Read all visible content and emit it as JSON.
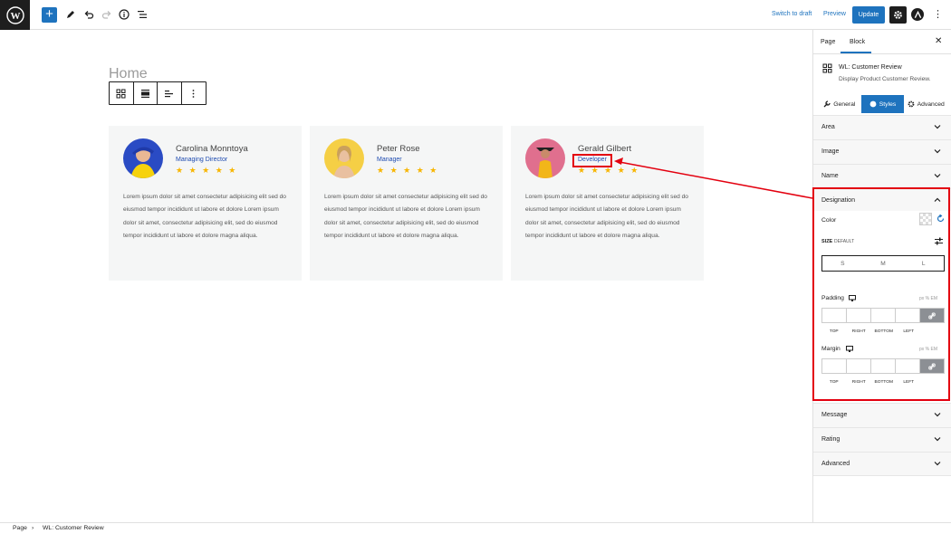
{
  "topbar": {
    "add_symbol": "+",
    "switch_to_draft": "Switch to draft",
    "preview": "Preview",
    "update": "Update",
    "more": "⋮",
    "icons": [
      "wordpress-icon",
      "pencil-icon",
      "undo-icon",
      "redo-icon",
      "info-icon",
      "list-view-icon",
      "gear-icon",
      "astra-icon"
    ]
  },
  "canvas": {
    "page_title": "Home",
    "cards": [
      {
        "name": "Carolina Monntoya",
        "designation": "Managing Director",
        "stars": "★ ★ ★ ★ ★",
        "rating": 5,
        "message": "Lorem ipsum dolor sit amet consectetur adipisicing elit sed do eiusmod tempor incididunt ut labore et dolore Lorem ipsum dolor sit amet, consectetur adipisicing elit, sed do eiusmod tempor incididunt ut labore et dolore magna aliqua."
      },
      {
        "name": "Peter Rose",
        "designation": "Manager",
        "stars": "★ ★ ★ ★ ★",
        "rating": 5,
        "message": "Lorem ipsum dolor sit amet consectetur adipisicing elit sed do eiusmod tempor incididunt ut labore et dolore Lorem ipsum dolor sit amet, consectetur adipisicing elit, sed do eiusmod tempor incididunt ut labore et dolore magna aliqua."
      },
      {
        "name": "Gerald Gilbert",
        "designation": "Developer",
        "stars": "★ ★ ★ ★ ★",
        "rating": 5,
        "message": "Lorem ipsum dolor sit amet consectetur adipisicing elit sed do eiusmod tempor incididunt ut labore et dolore Lorem ipsum dolor sit amet, consectetur adipisicing elit, sed do eiusmod tempor incididunt ut labore et dolore magna aliqua."
      }
    ]
  },
  "sidebar": {
    "tabs": [
      "Page",
      "Block"
    ],
    "close": "✕",
    "block_name": "WL: Customer Review",
    "block_desc": "Display Product Customer Review.",
    "style_tabs": [
      "General",
      "Styles",
      "Advanced"
    ],
    "sections_top": [
      "Area",
      "Image",
      "Name"
    ],
    "designation": {
      "title": "Designation",
      "color_label": "Color",
      "size_label": "SIZE",
      "size_default": "DEFAULT",
      "sizes": [
        "S",
        "M",
        "L"
      ],
      "padding_label": "Padding",
      "margin_label": "Margin",
      "units": "px % EM",
      "sides": [
        "TOP",
        "RIGHT",
        "BOTTOM",
        "LEFT"
      ]
    },
    "sections_bottom": [
      "Message",
      "Rating",
      "Advanced"
    ]
  },
  "footer": {
    "crumb_page": "Page",
    "crumb_sep": "›",
    "crumb_block": "WL: Customer Review"
  },
  "colors": {
    "accent": "#1e73be",
    "highlight": "#e3000f",
    "star": "#f7b500",
    "designation_text": "#1e4bb0"
  }
}
